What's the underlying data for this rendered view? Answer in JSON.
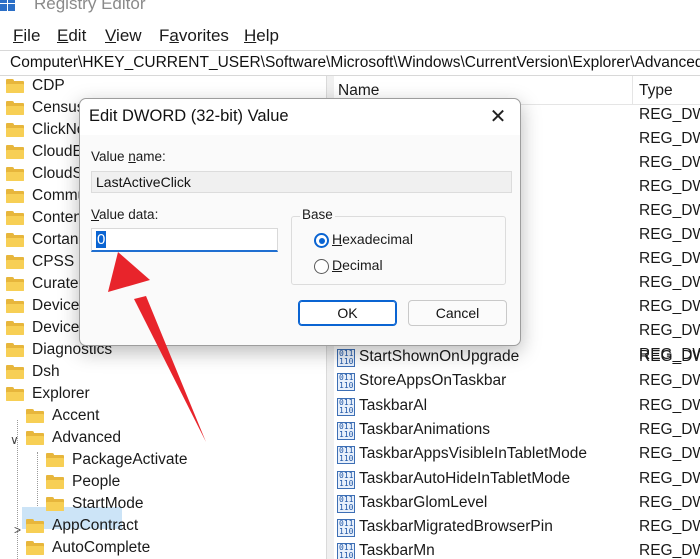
{
  "window": {
    "title": "Registry Editor"
  },
  "menu": [
    {
      "pre": "",
      "u": "F",
      "post": "ile"
    },
    {
      "pre": "",
      "u": "E",
      "post": "dit"
    },
    {
      "pre": "",
      "u": "V",
      "post": "iew"
    },
    {
      "pre": "F",
      "u": "a",
      "post": "vorites"
    },
    {
      "pre": "",
      "u": "H",
      "post": "elp"
    }
  ],
  "address": "Computer\\HKEY_CURRENT_USER\\Software\\Microsoft\\Windows\\CurrentVersion\\Explorer\\Advanced",
  "tree": {
    "items": [
      "CDP",
      "Census",
      "ClickNo",
      "CloudE",
      "CloudS",
      "Commu",
      "Conten",
      "Cortana",
      "CPSS",
      "Curated",
      "Device",
      "Device",
      "Diagnostics",
      "Dsh",
      "Explorer",
      "Accent",
      "Advanced",
      "PackageActivate",
      "People",
      "StartMode",
      "AppContract",
      "AutoComplete"
    ],
    "expand_glyph": "∨",
    "collapsed_glyph": ">"
  },
  "list": {
    "columns": {
      "name": "Name",
      "type": "Type"
    },
    "rows_top_types": [
      "REG_DWO",
      "REG_DWO",
      "REG_DWO",
      "REG_DWO",
      "REG_DWO",
      "REG_DWO",
      "REG_DWO",
      "REG_DWO",
      "REG_DWO",
      "REG_DWO",
      "REG_DWO"
    ],
    "rows": [
      {
        "name": "StartShownOnUpgrade",
        "type": "REG_DWO"
      },
      {
        "name": "StoreAppsOnTaskbar",
        "type": "REG_DWO"
      },
      {
        "name": "TaskbarAl",
        "type": "REG_DWO"
      },
      {
        "name": "TaskbarAnimations",
        "type": "REG_DWO"
      },
      {
        "name": "TaskbarAppsVisibleInTabletMode",
        "type": "REG_DWO"
      },
      {
        "name": "TaskbarAutoHideInTabletMode",
        "type": "REG_DWO"
      },
      {
        "name": "TaskbarGlomLevel",
        "type": "REG_DWO"
      },
      {
        "name": "TaskbarMigratedBrowserPin",
        "type": "REG_DWO"
      },
      {
        "name": "TaskbarMn",
        "type": "REG_DWO"
      }
    ],
    "reg_icon_bits": [
      "011",
      "110"
    ]
  },
  "dialog": {
    "title": "Edit DWORD (32-bit) Value",
    "close_glyph": "✕",
    "value_name_label": {
      "pre": "Value ",
      "u": "n",
      "post": "ame:"
    },
    "value_name": "LastActiveClick",
    "value_data_label": {
      "pre": "",
      "u": "V",
      "post": "alue data:"
    },
    "value_data": "0",
    "base_label": "Base",
    "hex": {
      "pre": "",
      "u": "H",
      "post": "exadecimal"
    },
    "dec": {
      "pre": "",
      "u": "D",
      "post": "ecimal"
    },
    "ok": "OK",
    "cancel": "Cancel"
  },
  "colors": {
    "accent": "#0a64d2",
    "arrow": "#e8242b",
    "folder": "#f7cf55"
  }
}
